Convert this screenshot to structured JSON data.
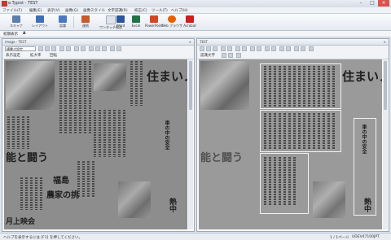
{
  "window": {
    "title": "e.Typist - TEST",
    "min": "–",
    "max": "□",
    "close": "×"
  },
  "menu": [
    "ファイル(F)",
    "編集(E)",
    "表示(V)",
    "画像(G)",
    "画像スタイル",
    "文字認識(R)",
    "校正(C)",
    "ツール(T)",
    "ヘルプ(H)"
  ],
  "ribbon": {
    "buttons": [
      {
        "label": "スキャナ",
        "color": "#5b7fb0"
      },
      {
        "label": "レイアウト",
        "color": "#3d6fb5"
      },
      {
        "label": "認識",
        "color": "#4a79c2"
      },
      {
        "label": "連続",
        "color": "#c65b2b"
      },
      {
        "label": "ワンタッチ転送",
        "color": "#e0e4ea"
      },
      {
        "label": "Word",
        "color": "#2b579a"
      },
      {
        "label": "Excel",
        "color": "#217346"
      },
      {
        "label": "PowerPoint",
        "color": "#d24726"
      },
      {
        "label": "Web ブラウザ",
        "color": "#e66000"
      },
      {
        "label": "Acrobat",
        "color": "#cc1f1f"
      }
    ]
  },
  "subbar": {
    "text": "初期表示",
    "marker": "A"
  },
  "left_pane": {
    "title": "image - TEST",
    "close": "×",
    "mode_select": "横書き設定",
    "tool1": "表示設定",
    "tool2": "拡大率",
    "tool3": "回転"
  },
  "right_pane": {
    "title": "TEST",
    "close": "×",
    "tool1": "認識文字"
  },
  "document": {
    "headline_big": "住まいノート",
    "headline_left": "能と闘う",
    "sub_fukushima": "福島",
    "sub_farmers": "農家の挑",
    "sub_safety": "車の中の安全",
    "sub_heat": "熱中",
    "caption": "月上映会"
  },
  "status": {
    "left": "ヘルプを表示するには [F1] を押してください。",
    "page": "1 / 1ページ",
    "code": "UDEV47100JPT"
  }
}
